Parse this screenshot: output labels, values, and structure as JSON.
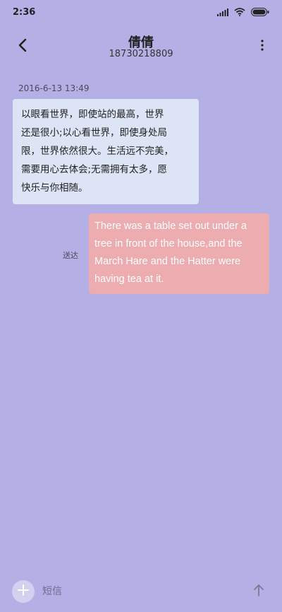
{
  "status_bar": {
    "time": "2:36",
    "icons": [
      "signal-icon",
      "wifi-icon",
      "battery-icon"
    ]
  },
  "header": {
    "contact_name": "倩倩",
    "contact_number": "18730218809",
    "back_icon": "back-arrow-icon",
    "more_icon": "more-vertical-icon"
  },
  "conversation": {
    "timestamp": "2016-6-13 13:49",
    "incoming_message": "以眼看世界，即使站的最高，世界\n还是很小;以心看世界，即使身处局\n限，世界依然很大。生活远不完美，\n需要用心去体会;无需拥有太多，愿\n快乐与你相随。",
    "outgoing_message": "There was a table set out under a tree in front of the house,and the March Hare and the Hatter were having tea at it.",
    "delivery_status": "送达"
  },
  "input_bar": {
    "placeholder": "短信",
    "add_icon": "plus-icon",
    "send_icon": "send-arrow-icon"
  },
  "colors": {
    "background": "#b4b0e6",
    "incoming_bubble": "#dce4f5",
    "outgoing_bubble": "#ecacb0"
  }
}
